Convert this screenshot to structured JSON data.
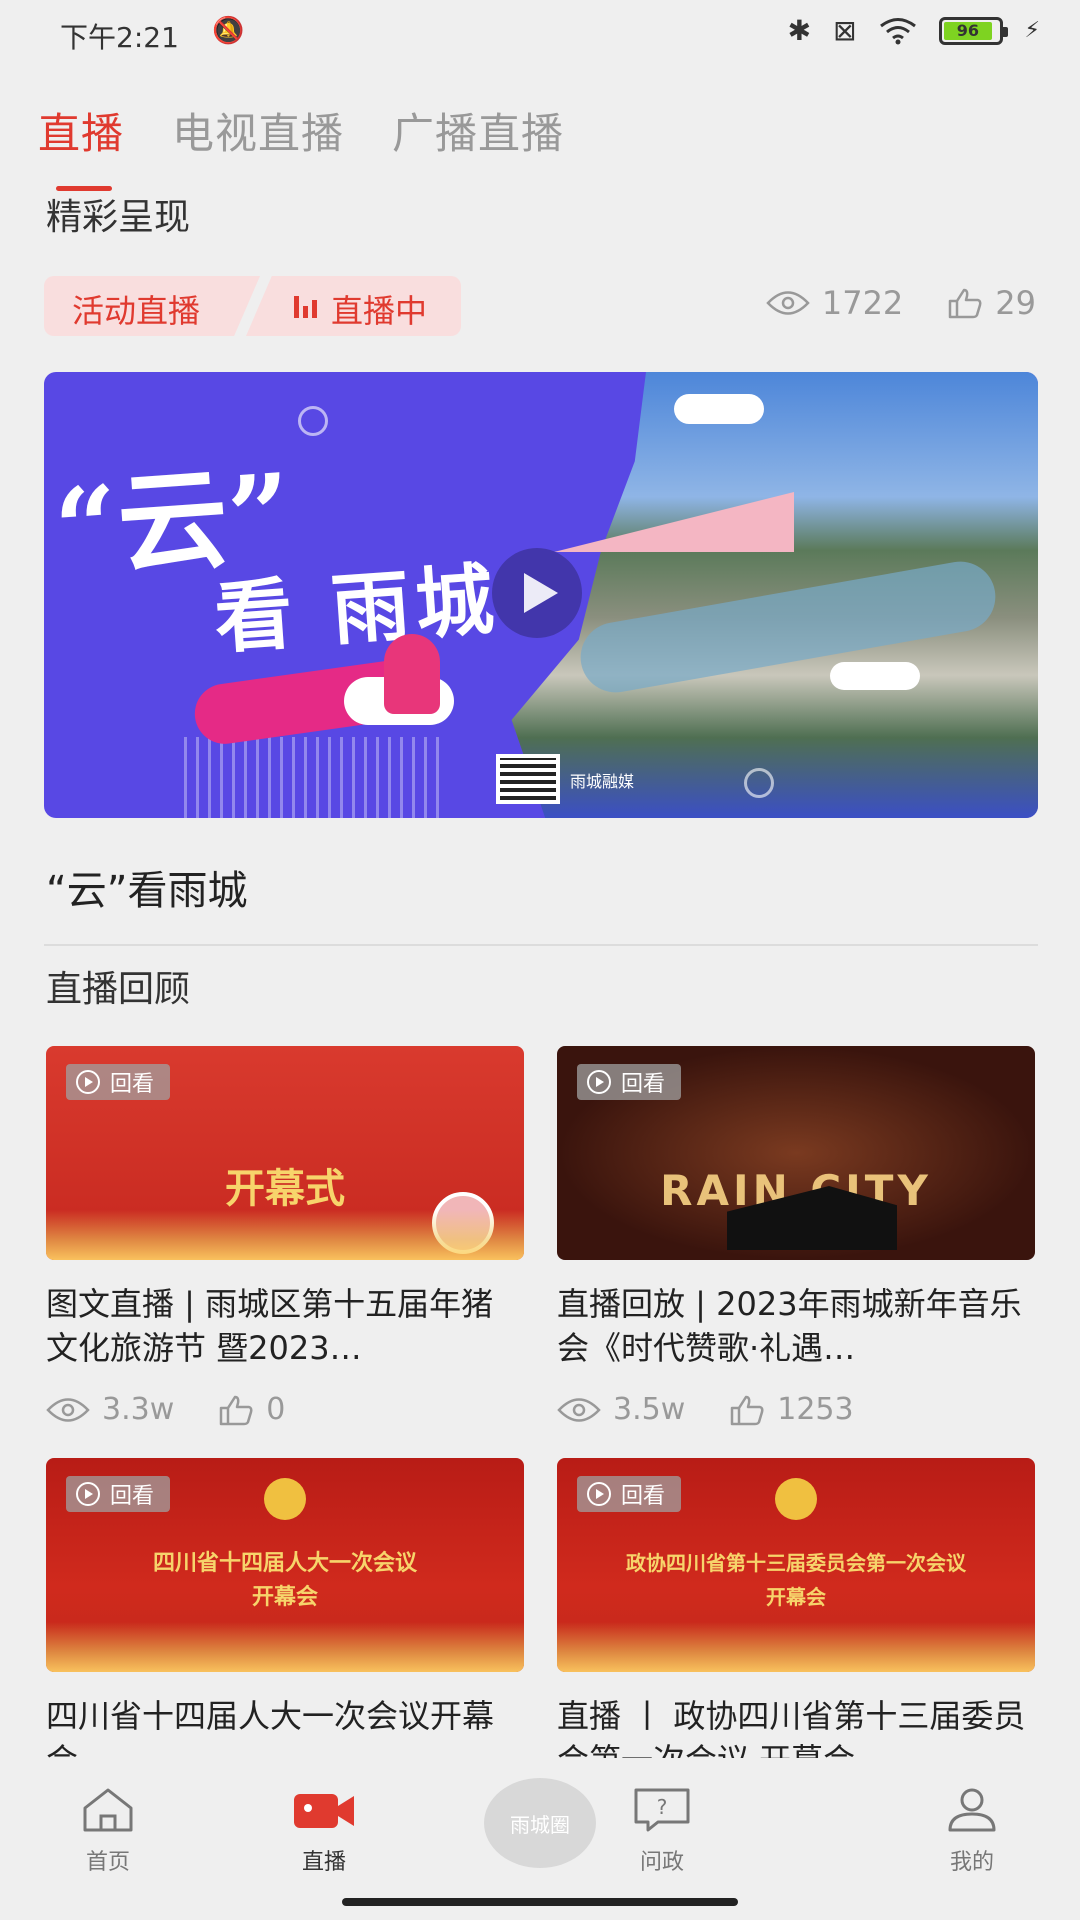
{
  "status_bar": {
    "time": "下午2:21",
    "battery": "96"
  },
  "tabs": [
    {
      "label": "直播"
    },
    {
      "label": "电视直播"
    },
    {
      "label": "广播直播"
    }
  ],
  "featured": {
    "section_title": "精彩呈现",
    "tag_category": "活动直播",
    "tag_status": "直播中",
    "views": "1722",
    "likes": "29",
    "banner": {
      "title_quote": "“云”",
      "title_main": "看 雨城",
      "brand": "雨城融媒"
    },
    "name": "“云”看雨城"
  },
  "review": {
    "section_title": "直播回顾",
    "badge_label": "回看",
    "items": [
      {
        "thumb_text": "开幕式",
        "title": "图文直播 | 雨城区第十五届年猪文化旅游节  暨2023…",
        "views": "3.3w",
        "likes": "0"
      },
      {
        "thumb_text": "RAIN CITY",
        "title": "直播回放 | 2023年雨城新年音乐会《时代赞歌·礼遇…",
        "views": "3.5w",
        "likes": "1253"
      },
      {
        "thumb_text": "四川省十四届人大一次会议\n开幕会",
        "title": "四川省十四届人大一次会议开幕会",
        "views": "",
        "likes": ""
      },
      {
        "thumb_text": "政协四川省第十三届委员会第一次会议\n开幕会",
        "title": "直播 丨 政协四川省第十三届委员会第一次会议 开幕会",
        "views": "",
        "likes": ""
      }
    ]
  },
  "bottom_nav": [
    {
      "label": "首页"
    },
    {
      "label": "直播"
    },
    {
      "label": "雨城圈"
    },
    {
      "label": "问政"
    },
    {
      "label": "我的"
    }
  ],
  "colors": {
    "accent": "#e03a2f",
    "muted": "#999999",
    "background": "#efefef"
  }
}
